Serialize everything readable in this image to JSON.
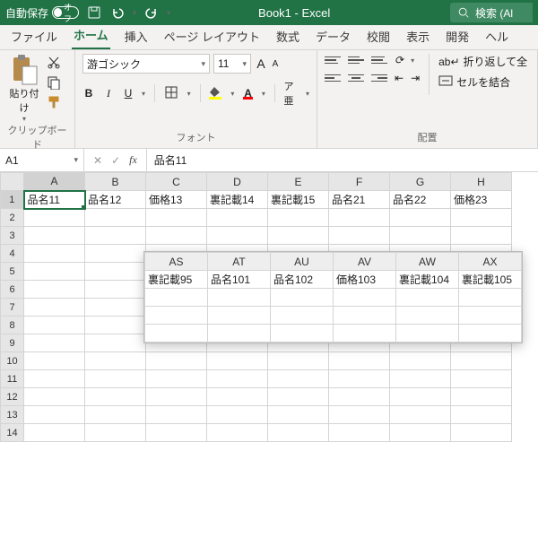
{
  "titlebar": {
    "autosave_label": "自動保存",
    "autosave_state": "オフ",
    "document": "Book1  -  Excel",
    "search_placeholder": "検索 (Al"
  },
  "tabs": {
    "file": "ファイル",
    "home": "ホーム",
    "insert": "挿入",
    "page_layout": "ページ レイアウト",
    "formulas": "数式",
    "data": "データ",
    "review": "校閲",
    "view": "表示",
    "developer": "開発",
    "help": "ヘル"
  },
  "ribbon": {
    "clipboard": {
      "paste": "貼り付け",
      "group": "クリップボード"
    },
    "font": {
      "name": "游ゴシック",
      "size": "11",
      "bold": "B",
      "italic": "I",
      "underline": "U",
      "increase": "A",
      "decrease": "A",
      "font_color_letter": "A",
      "group": "フォント"
    },
    "alignment": {
      "wrap": "折り返して全",
      "merge": "セルを結合",
      "group": "配置"
    }
  },
  "namebox": {
    "ref": "A1",
    "formula": "品名11"
  },
  "grid_main": {
    "cols": [
      "A",
      "B",
      "C",
      "D",
      "E",
      "F",
      "G",
      "H"
    ],
    "rows": [
      "1",
      "2",
      "3",
      "4",
      "5",
      "6",
      "7",
      "8",
      "9",
      "10",
      "11",
      "12",
      "13",
      "14"
    ],
    "row1": [
      "品名11",
      "品名12",
      "価格13",
      "裏記載14",
      "裏記載15",
      "品名21",
      "品名22",
      "価格23"
    ]
  },
  "grid_overlay": {
    "cols": [
      "AS",
      "AT",
      "AU",
      "AV",
      "AW",
      "AX"
    ],
    "row1": [
      "裏記載95",
      "品名101",
      "品名102",
      "価格103",
      "裏記載104",
      "裏記載105"
    ]
  },
  "chart_data": {
    "type": "table",
    "title": "Book1 - Excel",
    "series": [
      {
        "name": "main_row1",
        "categories": [
          "A",
          "B",
          "C",
          "D",
          "E",
          "F",
          "G",
          "H"
        ],
        "values": [
          "品名11",
          "品名12",
          "価格13",
          "裏記載14",
          "裏記載15",
          "品名21",
          "品名22",
          "価格23"
        ]
      },
      {
        "name": "overlay_row1",
        "categories": [
          "AS",
          "AT",
          "AU",
          "AV",
          "AW",
          "AX"
        ],
        "values": [
          "裏記載95",
          "品名101",
          "品名102",
          "価格103",
          "裏記載104",
          "裏記載105"
        ]
      }
    ]
  }
}
